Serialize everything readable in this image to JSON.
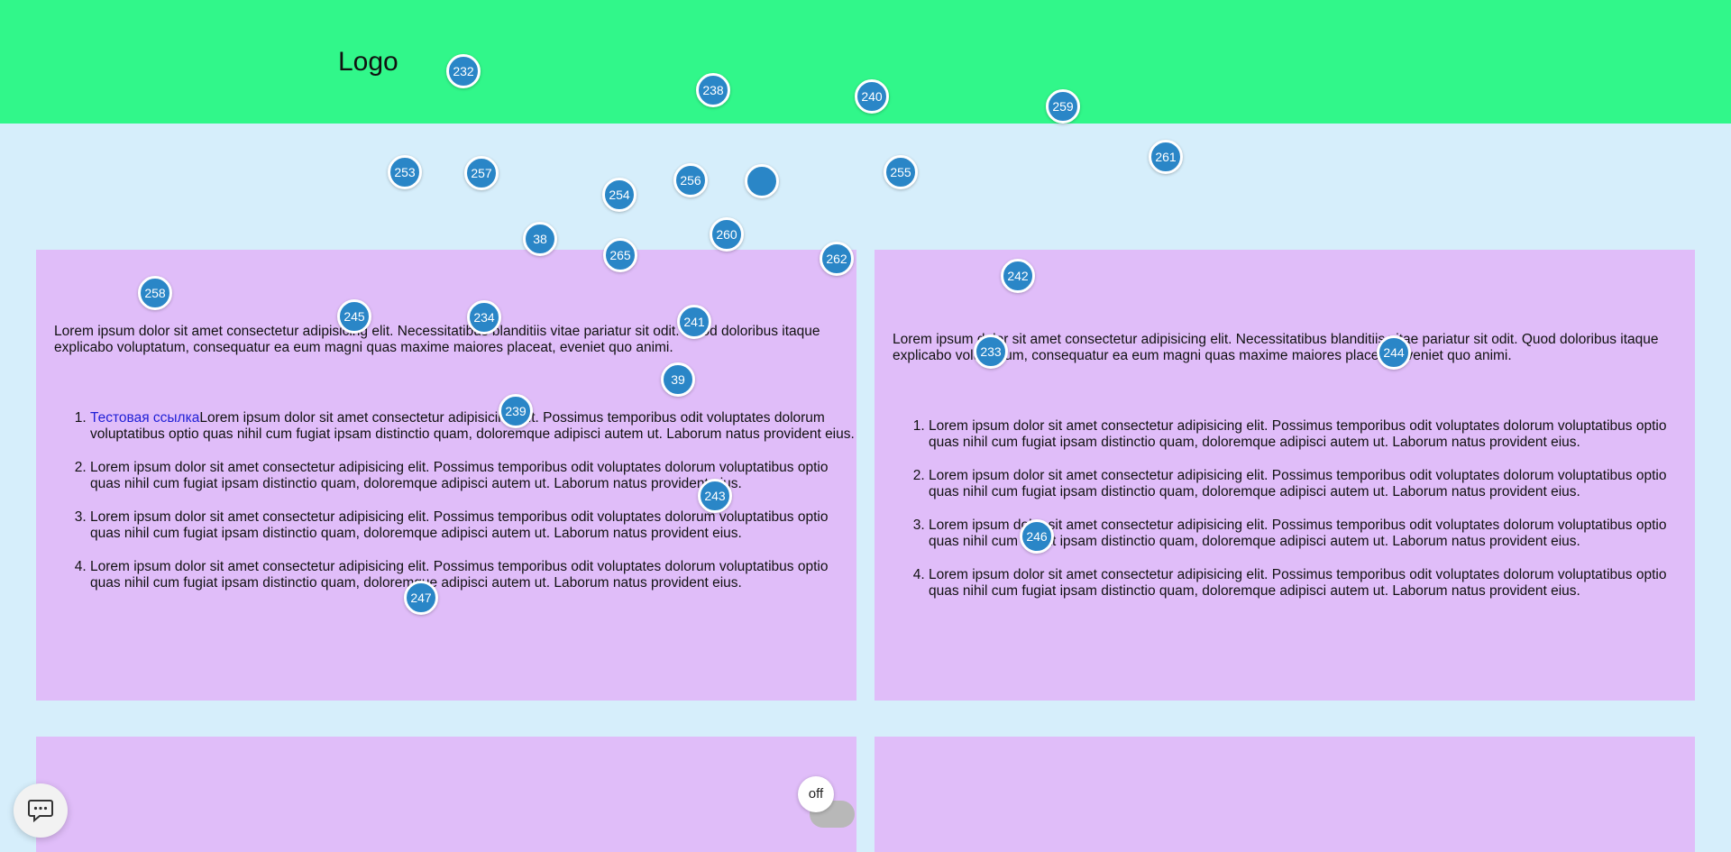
{
  "header": {
    "logo": "Logo",
    "background": "#31f78a"
  },
  "card_left": {
    "paragraph": "Lorem ipsum dolor sit amet consectetur adipisicing elit. Necessitatibus blanditiis vitae pariatur sit odit. Quod doloribus itaque explicabo voluptatum, consequatur ea eum magni quas maxime maiores placeat, eveniet quo animi.",
    "link": "Тестовая ссылка",
    "items": [
      "Lorem ipsum dolor sit amet consectetur adipisicing elit. Possimus temporibus odit voluptates dolorum voluptatibus optio quas nihil cum fugiat ipsam distinctio quam, doloremque adipisci autem ut. Laborum natus provident eius.",
      "Lorem ipsum dolor sit amet consectetur adipisicing elit. Possimus temporibus odit voluptates dolorum voluptatibus optio quas nihil cum fugiat ipsam distinctio quam, doloremque adipisci autem ut. Laborum natus provident eius.",
      "Lorem ipsum dolor sit amet consectetur adipisicing elit. Possimus temporibus odit voluptates dolorum voluptatibus optio quas nihil cum fugiat ipsam distinctio quam, doloremque adipisci autem ut. Laborum natus provident eius.",
      "Lorem ipsum dolor sit amet consectetur adipisicing elit. Possimus temporibus odit voluptates dolorum voluptatibus optio quas nihil cum fugiat ipsam distinctio quam, doloremque adipisci autem ut. Laborum natus provident eius."
    ]
  },
  "card_right": {
    "paragraph": "Lorem ipsum dolor sit amet consectetur adipisicing elit. Necessitatibus blanditiis vitae pariatur sit odit. Quod doloribus itaque explicabo voluptatum, consequatur ea eum magni quas maxime maiores placeat, eveniet quo animi.",
    "items": [
      "Lorem ipsum dolor sit amet consectetur adipisicing elit. Possimus temporibus odit voluptates dolorum voluptatibus optio quas nihil cum fugiat ipsam distinctio quam, doloremque adipisci autem ut. Laborum natus provident eius.",
      "Lorem ipsum dolor sit amet consectetur adipisicing elit. Possimus temporibus odit voluptates dolorum voluptatibus optio quas nihil cum fugiat ipsam distinctio quam, doloremque adipisci autem ut. Laborum natus provident eius.",
      "Lorem ipsum dolor sit amet consectetur adipisicing elit. Possimus temporibus odit voluptates dolorum voluptatibus optio quas nihil cum fugiat ipsam distinctio quam, doloremque adipisci autem ut. Laborum natus provident eius.",
      "Lorem ipsum dolor sit amet consectetur adipisicing elit. Possimus temporibus odit voluptates dolorum voluptatibus optio quas nihil cum fugiat ipsam distinctio quam, doloremque adipisci autem ut. Laborum natus provident eius."
    ]
  },
  "pins": [
    "232",
    "238",
    "240",
    "259",
    "261",
    "253",
    "257",
    "254",
    "256",
    "",
    "255",
    "38",
    "265",
    "260",
    "262",
    "258",
    "245",
    "234",
    "241",
    "242",
    "233",
    "244",
    "39",
    "239",
    "243",
    "246",
    "247"
  ],
  "toggle": {
    "label": "off",
    "state": "off"
  },
  "chat": {
    "icon": "chat-bubble-icon"
  },
  "colors": {
    "page_bg": "#d6eefb",
    "card_bg": "#e0bdf9",
    "pin": "#2a86c7",
    "link": "#1f1fd6"
  }
}
